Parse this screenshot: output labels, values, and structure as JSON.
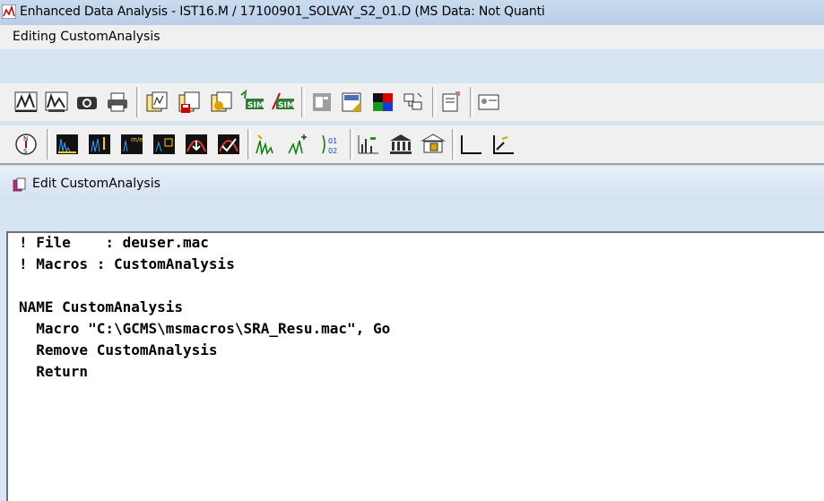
{
  "window": {
    "title": "Enhanced Data Analysis - IST16.M / 17100901_SOLVAY_S2_01.D   (MS Data: Not Quanti"
  },
  "menubar": {
    "label": "Editing CustomAnalysis"
  },
  "toolbar_row1": [
    "integrate-icon",
    "integrate-all-icon",
    "camera-icon",
    "print-icon",
    "report-icon",
    "save-report-icon",
    "run-report-icon",
    "sim-left-icon",
    "sim-right-icon",
    "window-icon",
    "load-icon",
    "color-icon",
    "network-icon",
    "doc-icon",
    "sample-icon"
  ],
  "toolbar_row2": [
    "compass-icon",
    "tic-icon",
    "extract-ion-icon",
    "mass-range-icon",
    "select-icon",
    "peak-down-icon",
    "peak-up-icon",
    "peak-spectrum-icon",
    "peak-star-icon",
    "peak-ratio-icon",
    "bar-chart-icon",
    "library-icon",
    "library-search-icon",
    "axis-icon",
    "calibrate-icon"
  ],
  "panel": {
    "title": "Edit CustomAnalysis"
  },
  "editor": {
    "lines": [
      "! File    : deuser.mac",
      "! Macros : CustomAnalysis",
      "",
      "NAME CustomAnalysis",
      "  Macro \"C:\\GCMS\\msmacros\\SRA_Resu.mac\", Go",
      "  Remove CustomAnalysis",
      "  Return"
    ]
  },
  "colors": {
    "titlebar": "#c9dbef",
    "panel_header": "#dce8f5",
    "editor_bg": "#ffffff",
    "panel_icon": "#d81b8f"
  }
}
